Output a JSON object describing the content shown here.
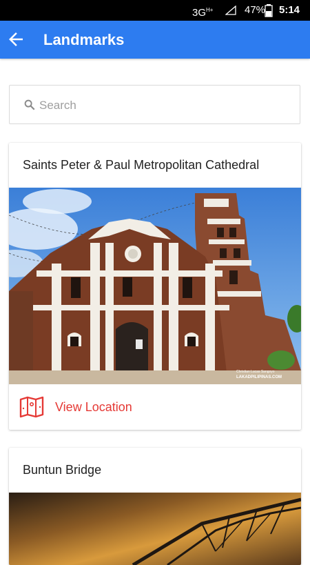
{
  "status_bar": {
    "network": "3G",
    "network_sup": "H+",
    "battery": "47%",
    "time": "5:14"
  },
  "app_bar": {
    "title": "Landmarks",
    "back_icon": "arrow-left-icon"
  },
  "search": {
    "placeholder": "Search",
    "icon": "search-icon"
  },
  "landmarks": [
    {
      "title": "Saints Peter & Paul Metropolitan Cathedral",
      "image_credit_1": "Christian Lucas Sangoyo",
      "image_credit_2": "LAKADPILIPINAS.COM",
      "action_label": "View Location",
      "action_icon": "map-icon"
    },
    {
      "title": "Buntun Bridge"
    }
  ],
  "colors": {
    "app_bar": "#2d7cf0",
    "accent": "#e53935"
  }
}
